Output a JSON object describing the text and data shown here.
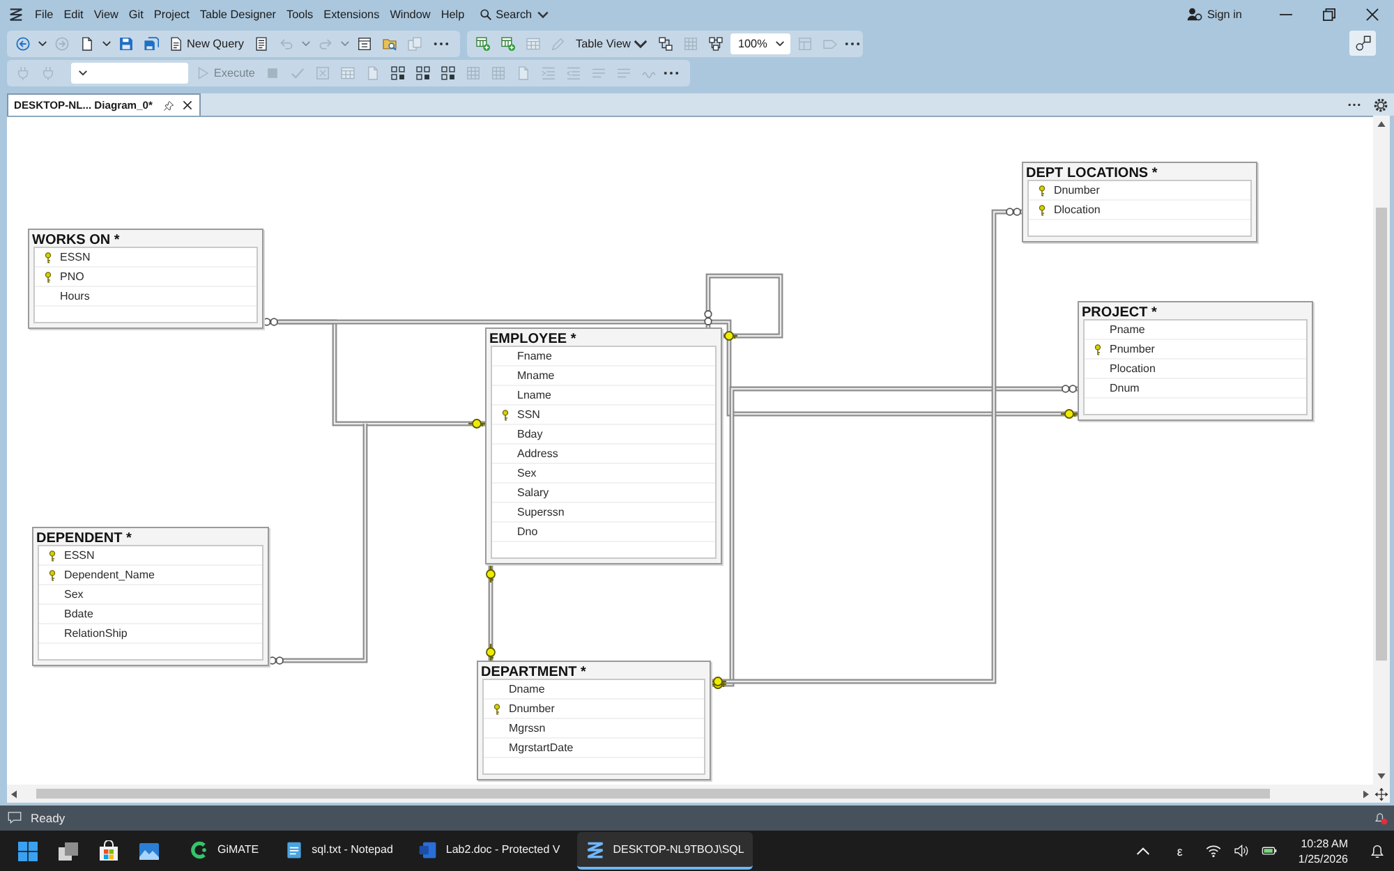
{
  "menu_bar": {
    "items": [
      "File",
      "Edit",
      "View",
      "Git",
      "Project",
      "Table Designer",
      "Tools",
      "Extensions",
      "Window",
      "Help"
    ],
    "search": "Search",
    "sign_in": "Sign in"
  },
  "toolbar": {
    "groups": [
      {
        "items": [
          {
            "kind": "icon",
            "disabled": false
          },
          {
            "kind": "caret",
            "disabled": false
          },
          {
            "kind": "icon",
            "disabled": true
          },
          {
            "kind": "icon",
            "disabled": false
          },
          {
            "kind": "caret",
            "disabled": false
          },
          {
            "kind": "icon",
            "disabled": false
          },
          {
            "kind": "icon",
            "disabled": false
          },
          {
            "kind": "button",
            "label": "New Query",
            "disabled": false
          },
          {
            "kind": "icon",
            "disabled": false
          },
          {
            "kind": "icon",
            "disabled": true
          },
          {
            "kind": "caret",
            "disabled": true
          },
          {
            "kind": "icon",
            "disabled": true
          },
          {
            "kind": "caret",
            "disabled": true
          },
          {
            "kind": "icon",
            "disabled": false
          },
          {
            "kind": "icon",
            "disabled": false
          },
          {
            "kind": "icon",
            "disabled": true
          },
          {
            "kind": "more",
            "disabled": false
          }
        ]
      },
      {
        "items": [
          {
            "kind": "icon",
            "disabled": false
          },
          {
            "kind": "icon",
            "disabled": false
          },
          {
            "kind": "icon",
            "disabled": true
          },
          {
            "kind": "icon",
            "disabled": true
          },
          {
            "kind": "dropdown",
            "label": "Table View",
            "disabled": false
          },
          {
            "kind": "icon",
            "disabled": false
          },
          {
            "kind": "icon",
            "disabled": true
          },
          {
            "kind": "icon",
            "disabled": false
          },
          {
            "kind": "combo",
            "label": "100%",
            "disabled": false
          },
          {
            "kind": "icon",
            "disabled": true
          },
          {
            "kind": "icon",
            "disabled": true
          },
          {
            "kind": "more",
            "disabled": false
          }
        ]
      },
      {
        "items": [
          {
            "kind": "icon",
            "disabled": true
          },
          {
            "kind": "icon",
            "disabled": true
          },
          {
            "kind": "combo",
            "disabled": false
          },
          {
            "kind": "button",
            "label": "Execute",
            "disabled": true
          },
          {
            "kind": "icon",
            "disabled": true
          },
          {
            "kind": "icon",
            "disabled": true
          },
          {
            "kind": "icon",
            "disabled": true
          },
          {
            "kind": "icon",
            "disabled": true
          },
          {
            "kind": "icon",
            "disabled": true
          },
          {
            "kind": "icon",
            "disabled": false
          },
          {
            "kind": "icon",
            "disabled": false
          },
          {
            "kind": "icon",
            "disabled": false
          },
          {
            "kind": "icon",
            "disabled": true
          },
          {
            "kind": "icon",
            "disabled": true
          },
          {
            "kind": "icon",
            "disabled": true
          },
          {
            "kind": "icon",
            "disabled": true
          },
          {
            "kind": "icon",
            "disabled": true
          },
          {
            "kind": "icon",
            "disabled": true
          },
          {
            "kind": "icon",
            "disabled": true
          },
          {
            "kind": "icon",
            "disabled": true
          },
          {
            "kind": "more",
            "disabled": false
          }
        ]
      }
    ]
  },
  "tabs": [
    {
      "label": "DESKTOP-NL... Diagram_0*",
      "selected": true
    }
  ],
  "diagram": {
    "tables": [
      {
        "title": "DEPT LOCATIONS *",
        "columns": [
          {
            "name": "Dnumber",
            "primary_key": true
          },
          {
            "name": "Dlocation",
            "primary_key": true
          }
        ]
      },
      {
        "title": "WORKS ON *",
        "columns": [
          {
            "name": "ESSN",
            "primary_key": true
          },
          {
            "name": "PNO",
            "primary_key": true
          },
          {
            "name": "Hours",
            "primary_key": false
          }
        ]
      },
      {
        "title": "PROJECT *",
        "columns": [
          {
            "name": "Pname",
            "primary_key": false
          },
          {
            "name": "Pnumber",
            "primary_key": true
          },
          {
            "name": "Plocation",
            "primary_key": false
          },
          {
            "name": "Dnum",
            "primary_key": false
          }
        ]
      },
      {
        "title": "EMPLOYEE *",
        "columns": [
          {
            "name": "Fname",
            "primary_key": false
          },
          {
            "name": "Mname",
            "primary_key": false
          },
          {
            "name": "Lname",
            "primary_key": false
          },
          {
            "name": "SSN",
            "primary_key": true
          },
          {
            "name": "Bday",
            "primary_key": false
          },
          {
            "name": "Address",
            "primary_key": false
          },
          {
            "name": "Sex",
            "primary_key": false
          },
          {
            "name": "Salary",
            "primary_key": false
          },
          {
            "name": "Superssn",
            "primary_key": false
          },
          {
            "name": "Dno",
            "primary_key": false
          }
        ]
      },
      {
        "title": "DEPENDENT *",
        "columns": [
          {
            "name": "ESSN",
            "primary_key": true
          },
          {
            "name": "Dependent_Name",
            "primary_key": true
          },
          {
            "name": "Sex",
            "primary_key": false
          },
          {
            "name": "Bdate",
            "primary_key": false
          },
          {
            "name": "RelationShip",
            "primary_key": false
          }
        ]
      },
      {
        "title": "DEPARTMENT *",
        "columns": [
          {
            "name": "Dname",
            "primary_key": false
          },
          {
            "name": "Dnumber",
            "primary_key": true
          },
          {
            "name": "Mgrssn",
            "primary_key": false
          },
          {
            "name": "MgrstartDate",
            "primary_key": false
          }
        ]
      }
    ]
  },
  "status_bar": {
    "text": "Ready"
  },
  "taskbar": {
    "apps": [
      {
        "label": "GiMATE",
        "selected": false
      },
      {
        "label": "sql.txt - Notepad",
        "selected": false
      },
      {
        "label": "Lab2.doc - Protected V",
        "selected": false
      },
      {
        "label": "DESKTOP-NL9TBOJ\\SQL",
        "selected": true
      }
    ],
    "input_indicator": "ε",
    "time": "10:28 AM",
    "date": "1/25/2026"
  }
}
